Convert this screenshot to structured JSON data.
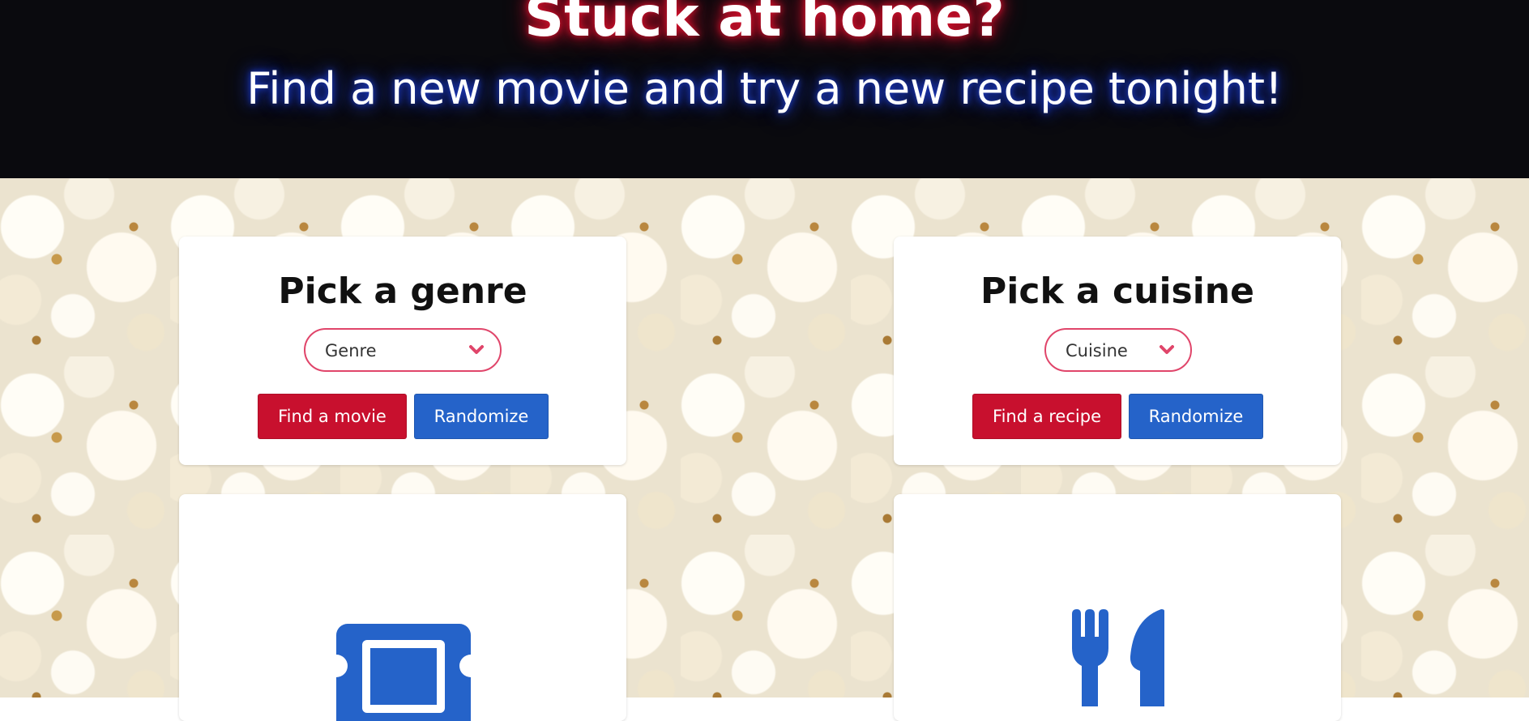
{
  "hero": {
    "title": "Stuck at home?",
    "subtitle": "Find a new movie and try a new recipe tonight!"
  },
  "movie_card": {
    "title": "Pick a genre",
    "select_value": "Genre",
    "find_button": "Find a movie",
    "random_button": "Randomize",
    "icon": "ticket-icon"
  },
  "recipe_card": {
    "title": "Pick a cuisine",
    "select_value": "Cuisine",
    "find_button": "Find a recipe",
    "random_button": "Randomize",
    "icon": "fork-knife-icon"
  },
  "colors": {
    "accent_red": "#c8102e",
    "accent_blue": "#2563c9",
    "select_border": "#e0456a",
    "hero_background": "#0a0a0e",
    "title_glow": "#d4102c",
    "subtitle_glow": "#1f3fd0"
  }
}
